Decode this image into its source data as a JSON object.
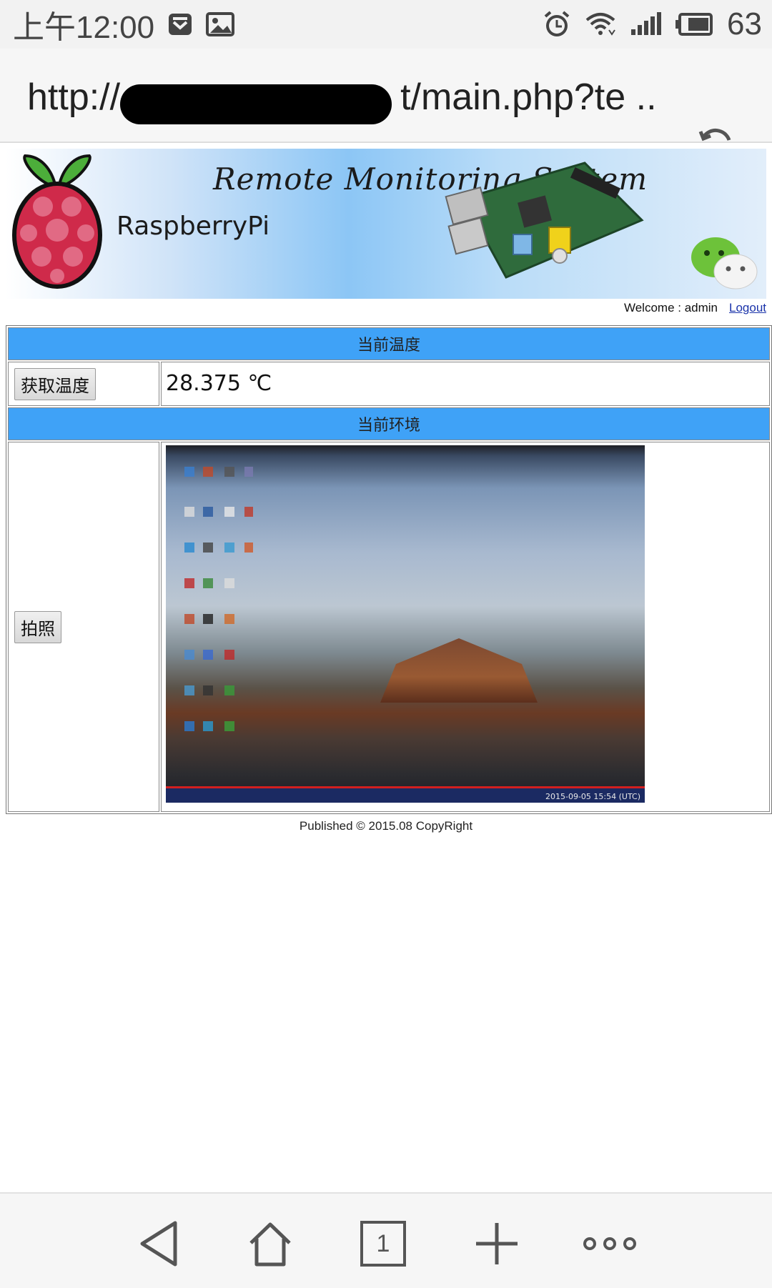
{
  "status_bar": {
    "time": "上午12:00",
    "battery_level": "63",
    "icons": [
      "notification-shield-icon",
      "gallery-icon",
      "alarm-icon",
      "wifi-icon",
      "signal-icon",
      "battery-icon"
    ]
  },
  "url_bar": {
    "url_prefix": "http://",
    "url_suffix": "t/main.php?te ..",
    "reload_icon": "reload-icon"
  },
  "banner": {
    "title": "Remote Monitoring System",
    "brand": "RaspberryPi"
  },
  "user": {
    "welcome": "Welcome : admin",
    "logout": "Logout"
  },
  "temperature_section": {
    "header": "当前温度",
    "button": "获取温度",
    "value": "28.375 ℃"
  },
  "environment_section": {
    "header": "当前环境",
    "button": "拍照",
    "photo_timestamp": "2015-09-05 15:54 (UTC)"
  },
  "footer": "Published © 2015.08 CopyRight",
  "bottom_nav": {
    "tab_count": "1",
    "icons": [
      "back-icon",
      "home-icon",
      "tabs-icon",
      "new-tab-icon",
      "more-icon"
    ]
  },
  "colors": {
    "section_header": "#3fa2f7",
    "logout_link": "#1a33aa"
  }
}
